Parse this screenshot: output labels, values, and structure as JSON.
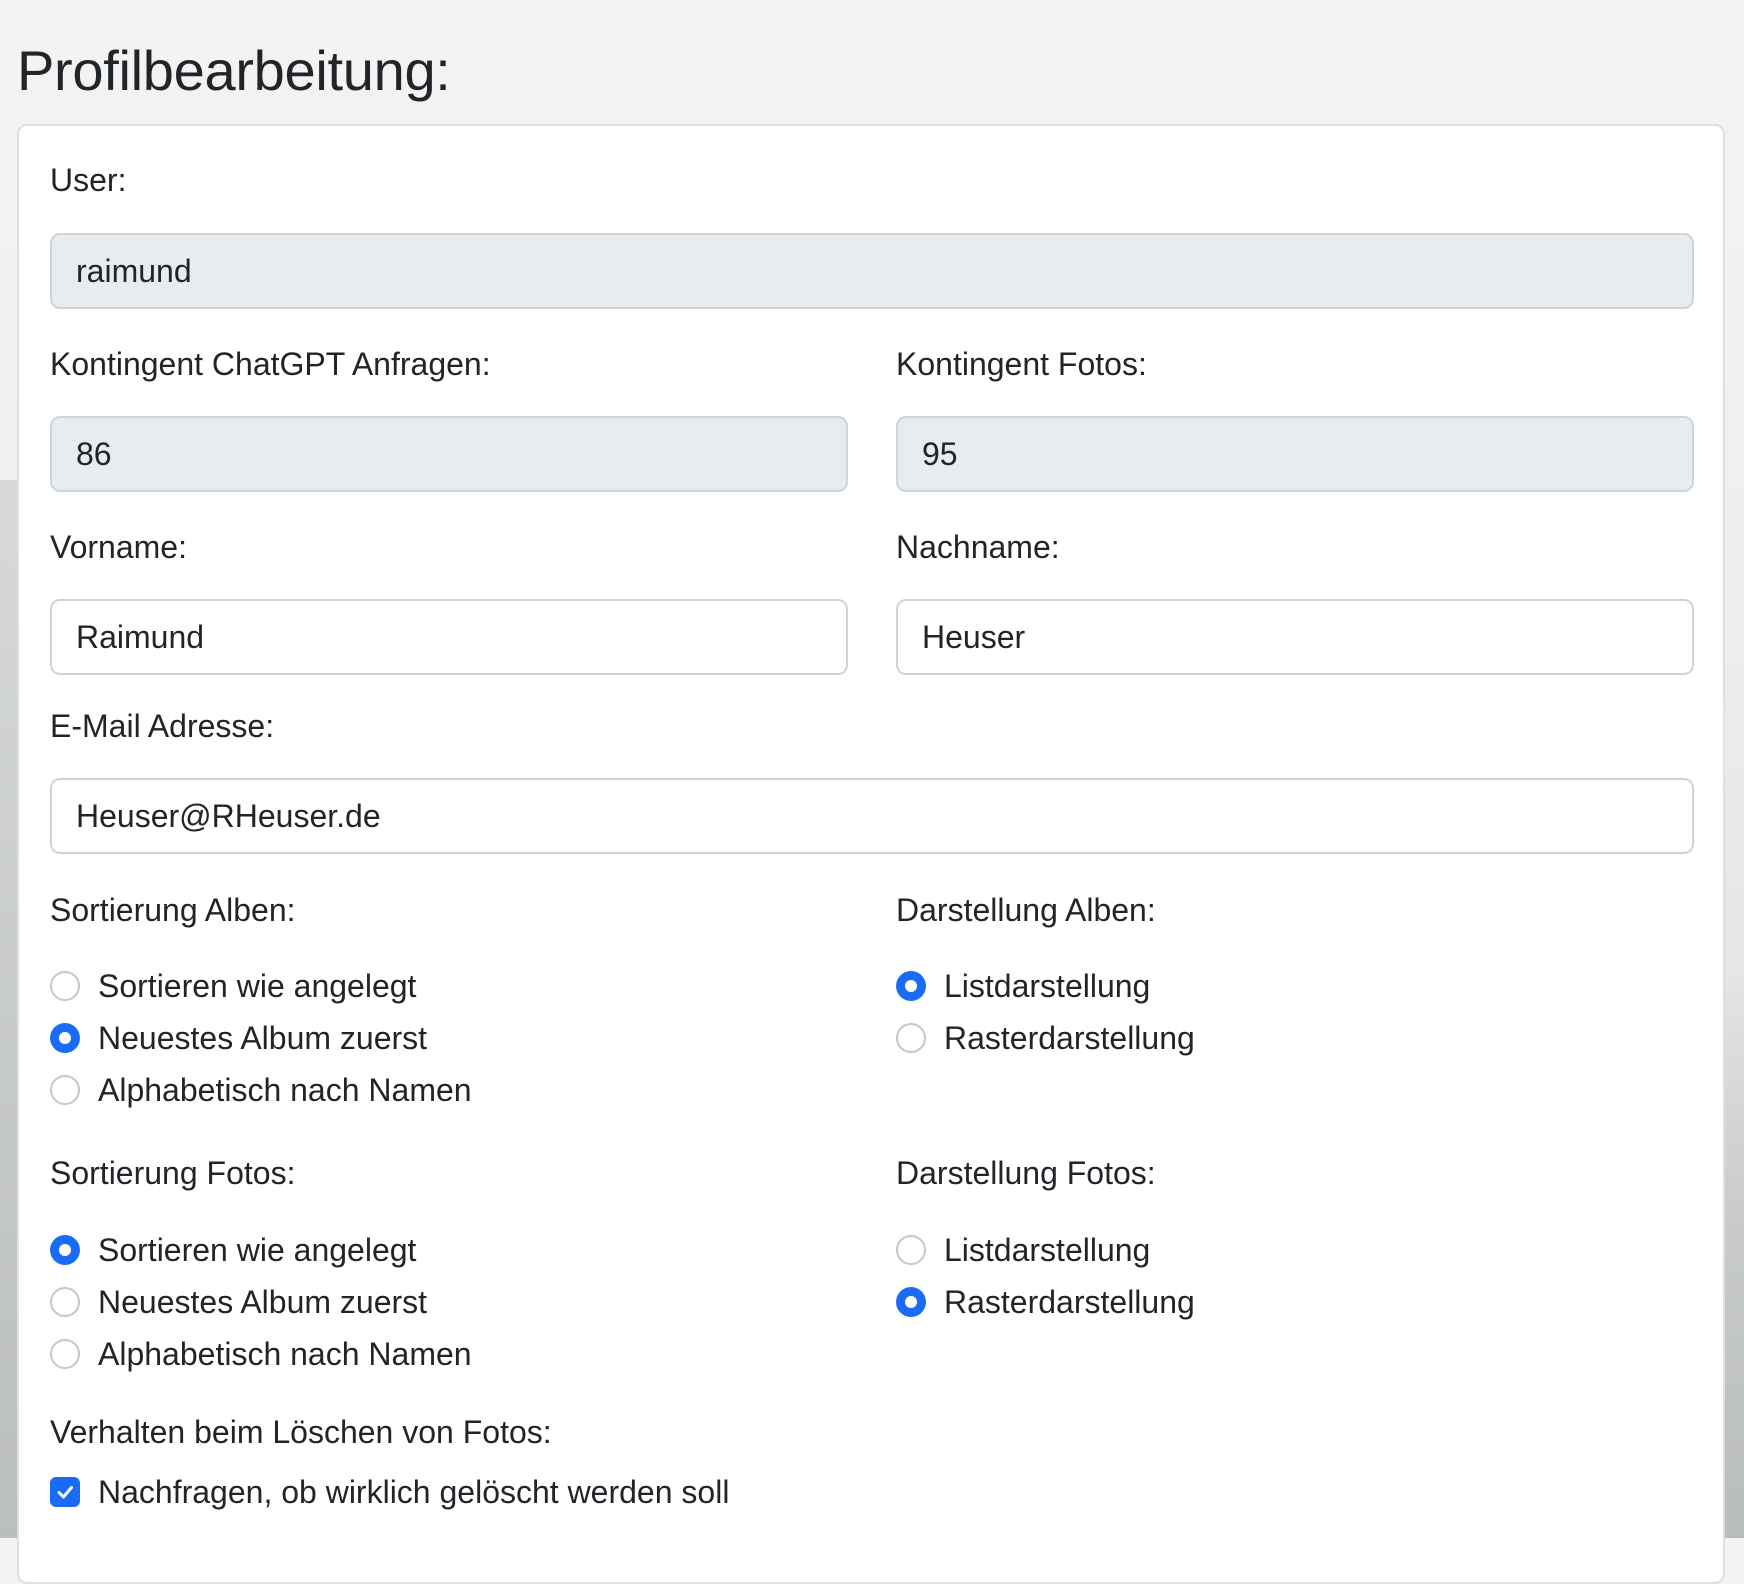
{
  "page": {
    "title": "Profilbearbeitung:"
  },
  "fields": {
    "user": {
      "label": "User:",
      "value": "raimund"
    },
    "kontingent_chatgpt": {
      "label": "Kontingent ChatGPT Anfragen:",
      "value": "86"
    },
    "kontingent_fotos": {
      "label": "Kontingent Fotos:",
      "value": "95"
    },
    "vorname": {
      "label": "Vorname:",
      "value": "Raimund"
    },
    "nachname": {
      "label": "Nachname:",
      "value": "Heuser"
    },
    "email": {
      "label": "E-Mail Adresse:",
      "value": "Heuser@RHeuser.de"
    }
  },
  "sortierung_alben": {
    "label": "Sortierung Alben:",
    "options": [
      {
        "label": "Sortieren wie angelegt",
        "checked": false
      },
      {
        "label": "Neuestes Album zuerst",
        "checked": true
      },
      {
        "label": "Alphabetisch nach Namen",
        "checked": false
      }
    ]
  },
  "darstellung_alben": {
    "label": "Darstellung Alben:",
    "options": [
      {
        "label": "Listdarstellung",
        "checked": true
      },
      {
        "label": "Rasterdarstellung",
        "checked": false
      }
    ]
  },
  "sortierung_fotos": {
    "label": "Sortierung Fotos:",
    "options": [
      {
        "label": "Sortieren wie angelegt",
        "checked": true
      },
      {
        "label": "Neuestes Album zuerst",
        "checked": false
      },
      {
        "label": "Alphabetisch nach Namen",
        "checked": false
      }
    ]
  },
  "darstellung_fotos": {
    "label": "Darstellung Fotos:",
    "options": [
      {
        "label": "Listdarstellung",
        "checked": false
      },
      {
        "label": "Rasterdarstellung",
        "checked": true
      }
    ]
  },
  "loeschen": {
    "label": "Verhalten beim Löschen von Fotos:",
    "checkbox_label": "Nachfragen, ob wirklich gelöscht werden soll",
    "checked": true
  },
  "colors": {
    "accent": "#1a6cf5",
    "disabled_input_bg": "#e9ecef",
    "border": "#ced4da"
  }
}
